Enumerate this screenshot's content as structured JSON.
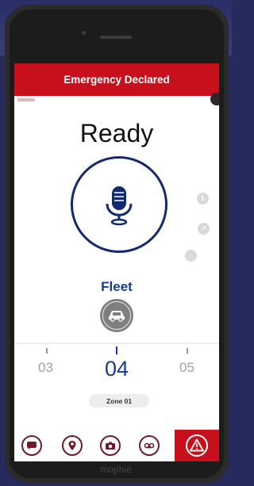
{
  "banner": {
    "text": "Emergency Declared"
  },
  "status": {
    "text": "Ready"
  },
  "channel": {
    "name": "Fleet"
  },
  "channel_selector": {
    "previous": "03",
    "current": "04",
    "next": "05",
    "zone": "Zone 01"
  },
  "device": {
    "brand": "mophie"
  },
  "colors": {
    "banner_red": "#c8101c",
    "accent_blue": "#173c8c",
    "ptt_ring": "#142a6e",
    "tab_outline": "#6e1a28"
  },
  "icons": {
    "ptt": "microphone-icon",
    "vehicle": "car-icon",
    "side": [
      "info-icon",
      "history-icon",
      "volume-icon"
    ],
    "tabs": [
      "messages-icon",
      "location-icon",
      "camera-icon",
      "voicemail-icon",
      "emergency-alert-icon"
    ]
  }
}
